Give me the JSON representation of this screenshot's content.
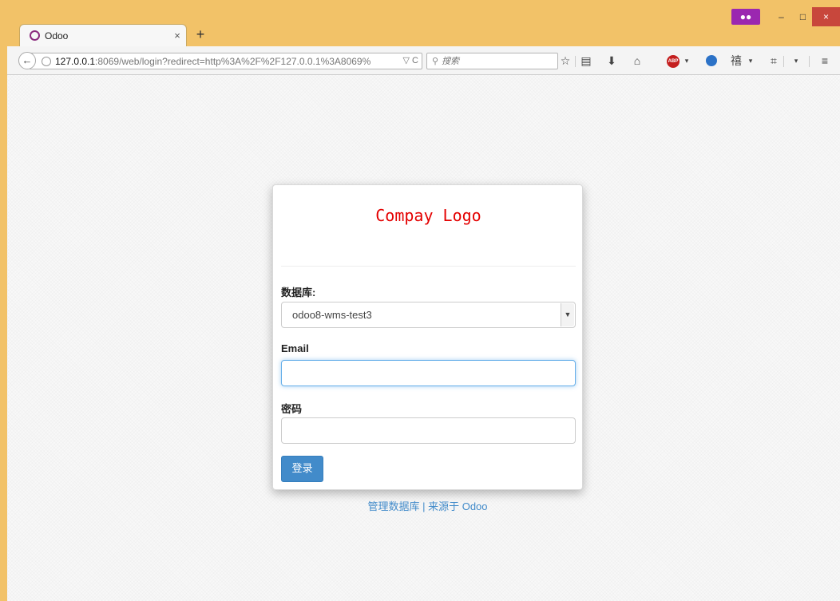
{
  "browser": {
    "tab_title": "Odoo",
    "tab_close": "×",
    "new_tab": "+",
    "url_host": "127.0.0.1",
    "url_rest": ":8069/web/login?redirect=http%3A%2F%2F127.0.0.1%3A8069%",
    "url_tools": "▽ C",
    "search_placeholder": "搜索",
    "window_minimize": "–",
    "window_maximize": "□",
    "window_close": "×"
  },
  "login": {
    "logo_text": "Compay Logo",
    "database_label": "数据库:",
    "database_selected": "odoo8-wms-test3",
    "email_label": "Email",
    "email_value": "",
    "password_label": "密码",
    "password_value": "",
    "submit_label": "登录"
  },
  "footer": {
    "manage_db_link": "管理数据库",
    "separator": " | ",
    "powered_by_link": "来源于 Odoo"
  },
  "colors": {
    "titlebar": "#f2c268",
    "logo_red": "#e40000",
    "primary_button": "#428bca",
    "link": "#428bca",
    "close_button": "#c8473c",
    "private_mask": "#9b27b0"
  },
  "icons": [
    "odoo-favicon-icon",
    "back-arrow-icon",
    "globe-icon",
    "search-icon",
    "bookmark-star-icon",
    "reading-list-icon",
    "download-icon",
    "home-icon",
    "adblock-icon",
    "sync-icon",
    "extension-icon",
    "crop-icon",
    "menu-icon",
    "private-mask-icon",
    "chevron-down-icon"
  ]
}
